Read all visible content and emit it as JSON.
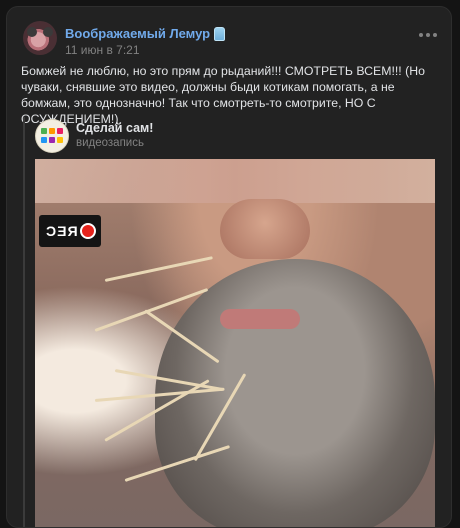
{
  "post": {
    "author": "Воображаемый Лемур",
    "date": "11 июн в 7:21",
    "text": "Бомжей не люблю, но это прям до рыданий!!! СМОТРЕТЬ ВСЕМ!!! (Но чуваки, снявшие это видео, должны быди котикам помогать, а не бомжам, это однозначно! Так что смотреть-то смотрите, НО С ОСУЖДЕНИЕМ!)"
  },
  "repost": {
    "title": "Сделай сам!",
    "subtitle": "видеозапись"
  },
  "video": {
    "overlay_label": "REC",
    "rec_color": "#e5231c"
  },
  "icons": {
    "more": "more-horizontal-icon",
    "author_badge": "jar-badge-icon"
  },
  "colors": {
    "background": "#141414",
    "card": "#222222",
    "link": "#71aaeb",
    "muted": "#828282"
  }
}
